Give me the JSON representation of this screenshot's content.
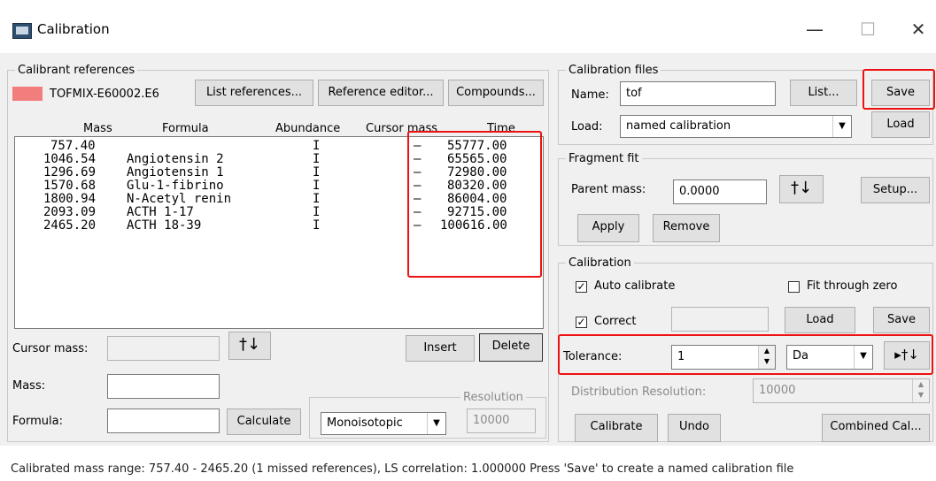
{
  "window": {
    "title": "Calibration",
    "minimize": "—",
    "maximize": "☐",
    "close": "✕"
  },
  "calibrant": {
    "group": "Calibrant references",
    "file": "TOFMIX-E60002.E6",
    "swatch_color": "#f27d7d",
    "list_refs": "List references...",
    "ref_editor": "Reference editor...",
    "compounds": "Compounds...",
    "columns": [
      "Mass",
      "Formula",
      "Abundance",
      "Cursor mass",
      "Time"
    ],
    "rows": [
      {
        "mass": "757.40",
        "formula": "",
        "abundance": "I",
        "cursor": "—",
        "time": "55777.00"
      },
      {
        "mass": "1046.54",
        "formula": "Angiotensin 2",
        "abundance": "I",
        "cursor": "—",
        "time": "65565.00"
      },
      {
        "mass": "1296.69",
        "formula": "Angiotensin 1",
        "abundance": "I",
        "cursor": "—",
        "time": "72980.00"
      },
      {
        "mass": "1570.68",
        "formula": "Glu-1-fibrino",
        "abundance": "I",
        "cursor": "—",
        "time": "80320.00"
      },
      {
        "mass": "1800.94",
        "formula": "N-Acetyl renin",
        "abundance": "I",
        "cursor": "—",
        "time": "86004.00"
      },
      {
        "mass": "2093.09",
        "formula": "ACTH 1-17",
        "abundance": "I",
        "cursor": "—",
        "time": "92715.00"
      },
      {
        "mass": "2465.20",
        "formula": "ACTH 18-39",
        "abundance": "I",
        "cursor": "—",
        "time": "100616.00"
      }
    ],
    "cursor_mass_label": "Cursor mass:",
    "cursor_btn": "†↓",
    "insert": "Insert",
    "delete": "Delete",
    "mass_label": "Mass:",
    "formula_label": "Formula:",
    "calculate": "Calculate",
    "isotope": "Monoisotopic",
    "resolution_label": "Resolution",
    "resolution_value": "10000"
  },
  "files": {
    "group": "Calibration files",
    "name_label": "Name:",
    "name_value": "tof",
    "list": "List...",
    "save": "Save",
    "load_label": "Load:",
    "load_value": "named calibration",
    "load_btn": "Load"
  },
  "fragment": {
    "group": "Fragment fit",
    "parent_label": "Parent mass:",
    "parent_value": "0.0000",
    "cursor_btn": "†↓",
    "setup": "Setup...",
    "apply": "Apply",
    "remove": "Remove"
  },
  "calibration": {
    "group": "Calibration",
    "auto_label": "Auto calibrate",
    "fit_zero_label": "Fit through zero",
    "correct_label": "Correct",
    "load": "Load",
    "save": "Save",
    "tolerance_label": "Tolerance:",
    "tolerance_value": "1",
    "unit": "Da",
    "peak_btn": "▸†↓",
    "dist_label": "Distribution Resolution:",
    "dist_value": "10000",
    "calibrate": "Calibrate",
    "undo": "Undo",
    "combined": "Combined Cal..."
  },
  "status": "Calibrated mass range: 757.40 - 2465.20 (1 missed references), LS correlation: 1.000000    Press 'Save' to create a named calibration file",
  "highlight_color": "#e11111"
}
